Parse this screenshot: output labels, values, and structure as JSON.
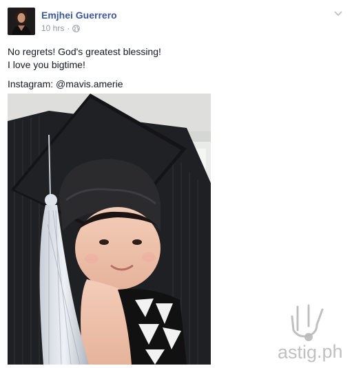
{
  "post": {
    "author": "Emjhei Guerrero",
    "time": "10 hrs",
    "separator": "·",
    "privacy_icon": "globe-icon",
    "options_icon": "chevron-down-icon",
    "lines": [
      "No regrets! God's greatest blessing!",
      "I love you bigtime!"
    ],
    "instagram": "Instagram: @mavis.amerie"
  },
  "watermark": {
    "text_main": "astig",
    "text_ext": ".ph"
  }
}
